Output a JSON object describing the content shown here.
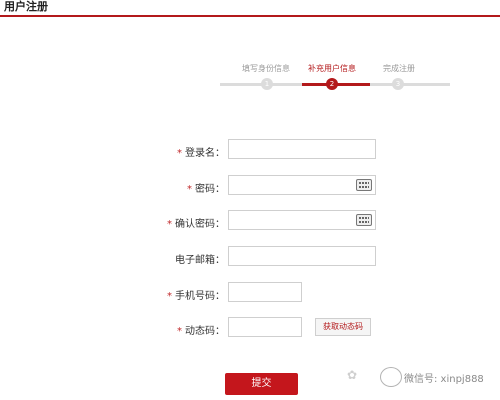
{
  "header": {
    "title": "用户注册"
  },
  "steps": [
    {
      "label": "填写身份信息",
      "number": "1",
      "active": false
    },
    {
      "label": "补充用户信息",
      "number": "2",
      "active": true
    },
    {
      "label": "完成注册",
      "number": "3",
      "active": false
    }
  ],
  "form": {
    "required_mark": "*",
    "fields": [
      {
        "label": "登录名：",
        "required": true,
        "value": ""
      },
      {
        "label": "密码：",
        "required": true,
        "value": ""
      },
      {
        "label": "确认密码：",
        "required": true,
        "value": ""
      },
      {
        "label": "电子邮箱：",
        "required": false,
        "value": ""
      },
      {
        "label": "手机号码：",
        "required": true,
        "value": ""
      },
      {
        "label": "动态码：",
        "required": true,
        "value": ""
      }
    ],
    "get_code_label": "获取动态码",
    "submit_label": "提交"
  },
  "watermark": {
    "text": "微信号: xinpj888"
  },
  "colors": {
    "accent": "#c4161c",
    "inactive_step": "#dcdcdc"
  }
}
